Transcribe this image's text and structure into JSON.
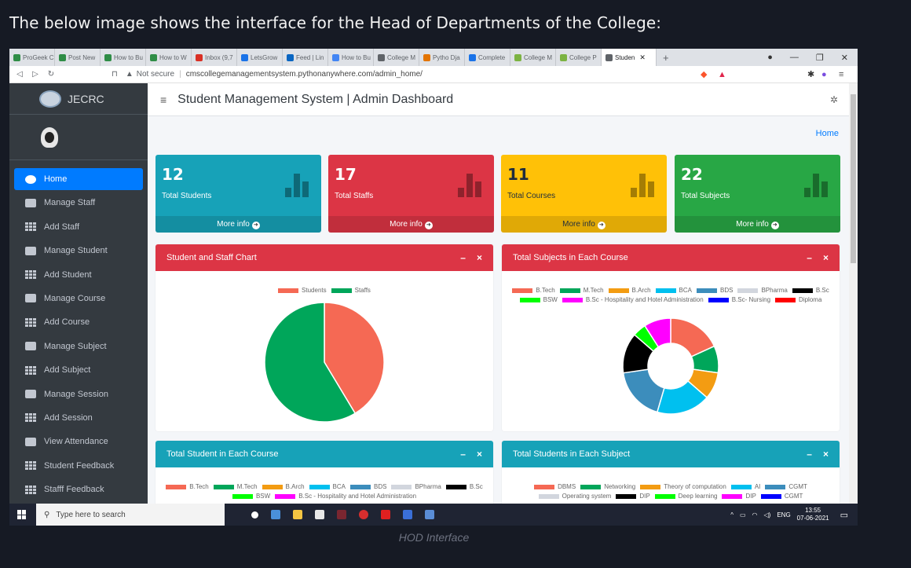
{
  "heading": "The below image shows the interface for the Head of Departments of the College:",
  "caption": "HOD Interface",
  "browser": {
    "tabs": [
      {
        "label": "ProGeek C",
        "color": "#2f8d46"
      },
      {
        "label": "Post New",
        "color": "#2f8d46"
      },
      {
        "label": "How to Bu",
        "color": "#2f8d46"
      },
      {
        "label": "How to W",
        "color": "#2f8d46"
      },
      {
        "label": "Inbox (9,7",
        "color": "#d93025"
      },
      {
        "label": "LetsGrow",
        "color": "#1a73e8"
      },
      {
        "label": "Feed | Lin",
        "color": "#0a66c2"
      },
      {
        "label": "How to Bu",
        "color": "#4285f4"
      },
      {
        "label": "College M",
        "color": "#5f6368"
      },
      {
        "label": "Pytho Dja",
        "color": "#e37400"
      },
      {
        "label": "Complete",
        "color": "#1a73e8"
      },
      {
        "label": "College M",
        "color": "#7cb342"
      },
      {
        "label": "College P",
        "color": "#7cb342"
      },
      {
        "label": "Studen",
        "color": "#5f6368"
      }
    ],
    "new_tab": "+",
    "not_secure": "Not secure",
    "url": "cmscollegemanagementsystem.pythonanywhere.com/admin_home/"
  },
  "sidebar": {
    "brand": "JECRC",
    "items": [
      {
        "label": "Home",
        "icon": "dashboard-icon"
      },
      {
        "label": "Manage Staff",
        "icon": "staff-icon"
      },
      {
        "label": "Add Staff",
        "icon": "grid-icon"
      },
      {
        "label": "Manage Student",
        "icon": "student-icon"
      },
      {
        "label": "Add Student",
        "icon": "grid-icon"
      },
      {
        "label": "Manage Course",
        "icon": "monitor-icon"
      },
      {
        "label": "Add Course",
        "icon": "grid-icon"
      },
      {
        "label": "Manage Subject",
        "icon": "book-icon"
      },
      {
        "label": "Add Subject",
        "icon": "grid-icon"
      },
      {
        "label": "Manage Session",
        "icon": "graduation-cap-icon"
      },
      {
        "label": "Add Session",
        "icon": "grid-icon"
      },
      {
        "label": "View Attendance",
        "icon": "calendar-icon"
      },
      {
        "label": "Student Feedback",
        "icon": "grid-icon"
      },
      {
        "label": "Stafff Feedback",
        "icon": "grid-icon"
      }
    ]
  },
  "header": {
    "title": "Student Management System | Admin Dashboard",
    "breadcrumb": "Home"
  },
  "stats": [
    {
      "value": "12",
      "label": "Total Students",
      "more": "More info",
      "color": "#17a2b8"
    },
    {
      "value": "17",
      "label": "Total Staffs",
      "more": "More info",
      "color": "#dc3545"
    },
    {
      "value": "11",
      "label": "Total Courses",
      "more": "More info",
      "color": "#ffc107"
    },
    {
      "value": "22",
      "label": "Total Subjects",
      "more": "More info",
      "color": "#28a745"
    }
  ],
  "cards": [
    {
      "title": "Student and Staff Chart",
      "color": "#dc3545"
    },
    {
      "title": "Total Subjects in Each Course",
      "color": "#dc3545"
    },
    {
      "title": "Total Student in Each Course",
      "color": "#17a2b8"
    },
    {
      "title": "Total Students in Each Subject",
      "color": "#17a2b8"
    }
  ],
  "card_tools": {
    "minimize": "–",
    "close": "×"
  },
  "chart_data": [
    {
      "type": "pie",
      "legend": [
        {
          "name": "Students",
          "color": "#f56954"
        },
        {
          "name": "Staffs",
          "color": "#00a65a"
        }
      ],
      "values": [
        12,
        17
      ]
    },
    {
      "type": "pie",
      "legend": [
        {
          "name": "B.Tech",
          "color": "#f56954"
        },
        {
          "name": "M.Tech",
          "color": "#00a65a"
        },
        {
          "name": "B.Arch",
          "color": "#f39c12"
        },
        {
          "name": "BCA",
          "color": "#00c0ef"
        },
        {
          "name": "BDS",
          "color": "#3c8dbc"
        },
        {
          "name": "BPharma",
          "color": "#d2d6de"
        },
        {
          "name": "B.Sc",
          "color": "#000000"
        },
        {
          "name": "BSW",
          "color": "#00ff00"
        },
        {
          "name": "B.Sc - Hospitality and Hotel Administration",
          "color": "#ff00ff"
        },
        {
          "name": "B.Sc- Nursing",
          "color": "#0000ff"
        },
        {
          "name": "Diploma",
          "color": "#ff0000"
        }
      ],
      "values": [
        4,
        2,
        2,
        4,
        4,
        0,
        3,
        1,
        2,
        0,
        0
      ]
    },
    {
      "type": "pie",
      "legend": [
        {
          "name": "B.Tech",
          "color": "#f56954"
        },
        {
          "name": "M.Tech",
          "color": "#00a65a"
        },
        {
          "name": "B.Arch",
          "color": "#f39c12"
        },
        {
          "name": "BCA",
          "color": "#00c0ef"
        },
        {
          "name": "BDS",
          "color": "#3c8dbc"
        },
        {
          "name": "BPharma",
          "color": "#d2d6de"
        },
        {
          "name": "B.Sc",
          "color": "#000000"
        },
        {
          "name": "BSW",
          "color": "#00ff00"
        },
        {
          "name": "B.Sc - Hospitality and Hotel Administration",
          "color": "#ff00ff"
        }
      ]
    },
    {
      "type": "pie",
      "legend": [
        {
          "name": "DBMS",
          "color": "#f56954"
        },
        {
          "name": "Networking",
          "color": "#00a65a"
        },
        {
          "name": "Theory of computation",
          "color": "#f39c12"
        },
        {
          "name": "AI",
          "color": "#00c0ef"
        },
        {
          "name": "CGMT",
          "color": "#3c8dbc"
        },
        {
          "name": "Operating system",
          "color": "#d2d6de"
        },
        {
          "name": "DIP",
          "color": "#000000"
        },
        {
          "name": "Deep learning",
          "color": "#00ff00"
        },
        {
          "name": "DIP",
          "color": "#ff00ff"
        },
        {
          "name": "CGMT",
          "color": "#0000ff"
        }
      ]
    }
  ],
  "taskbar": {
    "search_placeholder": "Type here to search",
    "lang": "ENG",
    "time": "13:55",
    "date": "07-06-2021"
  }
}
